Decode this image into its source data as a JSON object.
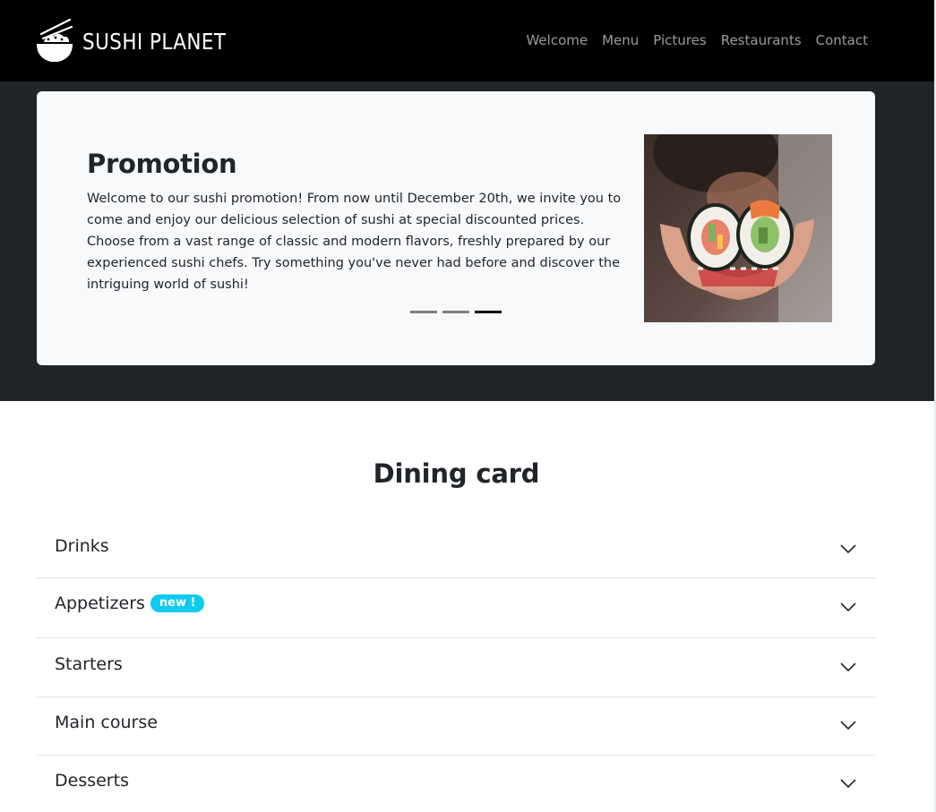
{
  "navbar": {
    "brand": "SUSHI PLANET",
    "links": [
      "Welcome",
      "Menu",
      "Pictures",
      "Restaurants",
      "Contact"
    ]
  },
  "promotion": {
    "title": "Promotion",
    "text": "Welcome to our sushi promotion! From now until December 20th, we invite you to come and enjoy our delicious selection of sushi at special discounted prices. Choose from a vast range of classic and modern flavors, freshly prepared by our experienced sushi chefs. Try something you've never had before and discover the intriguing world of sushi!",
    "slide_count": 3,
    "active_slide": 3
  },
  "dining": {
    "title": "Dining card",
    "items": [
      {
        "label": "Drinks",
        "badge": ""
      },
      {
        "label": "Appetizers",
        "badge": "new !"
      },
      {
        "label": "Starters",
        "badge": ""
      },
      {
        "label": "Main course",
        "badge": ""
      },
      {
        "label": "Desserts",
        "badge": ""
      }
    ]
  },
  "colors": {
    "navbar_bg": "#000000",
    "hero_bg": "#212529",
    "card_bg": "#f8f9fa",
    "badge_bg": "#0dcaf0"
  },
  "icons": {
    "brand_logo": "rice-bowl-chopsticks-icon",
    "accordion_toggle": "chevron-down-icon"
  }
}
